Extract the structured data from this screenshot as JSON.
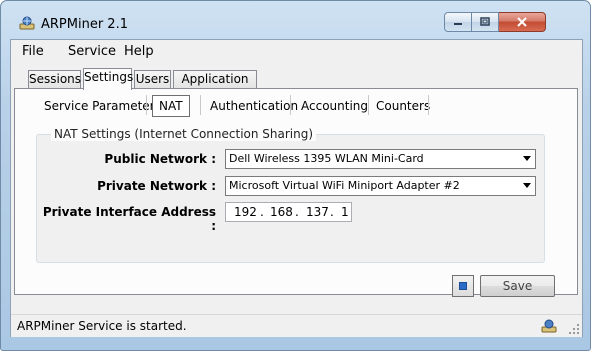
{
  "window": {
    "title": "ARPMiner 2.1",
    "controls": {
      "minimize": "minimize",
      "maximize": "maximize",
      "close": "close"
    }
  },
  "menu": [
    "File",
    "Service",
    "Help"
  ],
  "tabs": [
    {
      "label": "Sessions",
      "active": false
    },
    {
      "label": "Settings",
      "active": true
    },
    {
      "label": "Users",
      "active": false
    },
    {
      "label": "Application Log",
      "active": false
    }
  ],
  "subtabs": [
    {
      "label": "Service Parameters",
      "active": false
    },
    {
      "label": "NAT",
      "active": true
    },
    {
      "label": "Authentication",
      "active": false
    },
    {
      "label": "Accounting",
      "active": false
    },
    {
      "label": "Counters",
      "active": false
    }
  ],
  "nat": {
    "group_label": "NAT Settings (Internet Connection Sharing)",
    "public_network_label": "Public Network :",
    "public_network_value": "Dell Wireless 1395 WLAN Mini-Card",
    "private_network_label": "Private Network :",
    "private_network_value": "Microsoft Virtual WiFi Miniport Adapter #2",
    "private_address_label": "Private Interface Address :",
    "ip_octets": [
      "192",
      "168",
      "137",
      "1"
    ],
    "ip_dot": "."
  },
  "buttons": {
    "save_label": "Save"
  },
  "status": {
    "text": "ARPMiner Service is started."
  },
  "colors": {
    "title_gradient_top": "#cfe2f3",
    "close_red": "#c24b33",
    "accent_blue": "#2a6bc7"
  }
}
